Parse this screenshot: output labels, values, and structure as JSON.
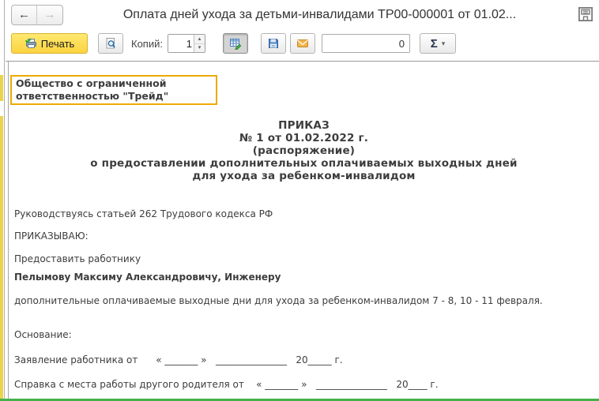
{
  "titlebar": {
    "title": "Оплата дней ухода за детьми-инвалидами ТР00-000001 от 01.02...",
    "back_glyph": "←",
    "forward_glyph": "→"
  },
  "toolbar": {
    "print_label": "Печать",
    "copies_label": "Копий:",
    "copies_value": "1",
    "spin_up": "▴",
    "spin_down": "▾",
    "counter_value": "0",
    "sigma_label": "Σ",
    "sigma_arrow": "▾"
  },
  "document": {
    "company": "Общество с ограниченной ответственностью \"Трейд\"",
    "heading": {
      "line1": "ПРИКАЗ",
      "line2": "№ 1 от 01.02.2022 г.",
      "line3": "(распоряжение)",
      "line4": "о предоставлении дополнительных оплачиваемых выходных дней",
      "line5": "для ухода за ребенком-инвалидом"
    },
    "body": {
      "guided": "Руководствуясь статьей 262 Трудового кодекса РФ",
      "order": "ПРИКАЗЫВАЮ:",
      "provide": "Предоставить работнику",
      "employee": "Пелымову Максиму Александровичу, Инженеру",
      "days": "дополнительные оплачиваемые выходные дни для ухода за ребенком-инвалидом 7 - 8, 10 - 11 февраля.",
      "basis": "Основание:",
      "statement": "Заявление работника от      « _______ »   _______________   20_____ г.",
      "certificate": "Справка с места работы другого родителя от    « _______ »   _______________   20____ г."
    }
  },
  "colors": {
    "print_button_yellow": "#fbd340",
    "selection_border_orange": "#edaa00",
    "bottom_edge_green": "#44b04a",
    "icon_blue": "#4d83c3",
    "envelope_orange": "#f2b44d"
  }
}
